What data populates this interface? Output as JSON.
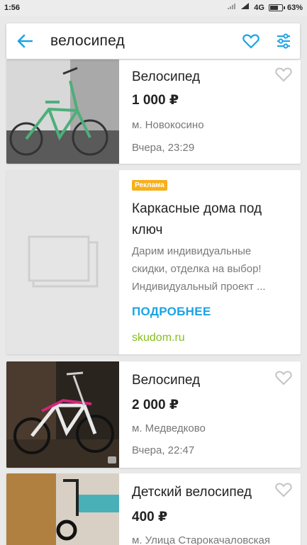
{
  "status": {
    "time": "1:56",
    "network": "4G",
    "battery": "63%",
    "battery_level": 0.63
  },
  "search": {
    "query": "велосипед"
  },
  "listings": [
    {
      "title": "Велосипед",
      "price": "1 000 ₽",
      "location": "м. Новокосино",
      "date": "Вчера, 23:29"
    },
    {
      "title": "Велосипед",
      "price": "2 000 ₽",
      "location": "м. Медведково",
      "date": "Вчера, 22:47"
    },
    {
      "title": "Детский велосипед",
      "price": "400 ₽",
      "location": "м. Улица Старокачаловская"
    }
  ],
  "ad": {
    "badge": "Реклама",
    "title_line1": "Каркасные дома под",
    "title_line2": "ключ",
    "desc_line1": "Дарим индивидуальные",
    "desc_line2": "скидки, отделка на выбор!",
    "desc_line3": "Индивидуальный проект ...",
    "more": "ПОДРОБНЕЕ",
    "domain": "skudom.ru"
  },
  "colors": {
    "accent": "#1aa3e6",
    "badge": "#f6b01b",
    "domain": "#85c01e"
  },
  "icons": {
    "back": "arrow-left-icon",
    "favorite": "heart-outline-icon",
    "filters": "sliders-icon",
    "camera": "camera-icon",
    "image_placeholder": "image-placeholder-icon"
  }
}
